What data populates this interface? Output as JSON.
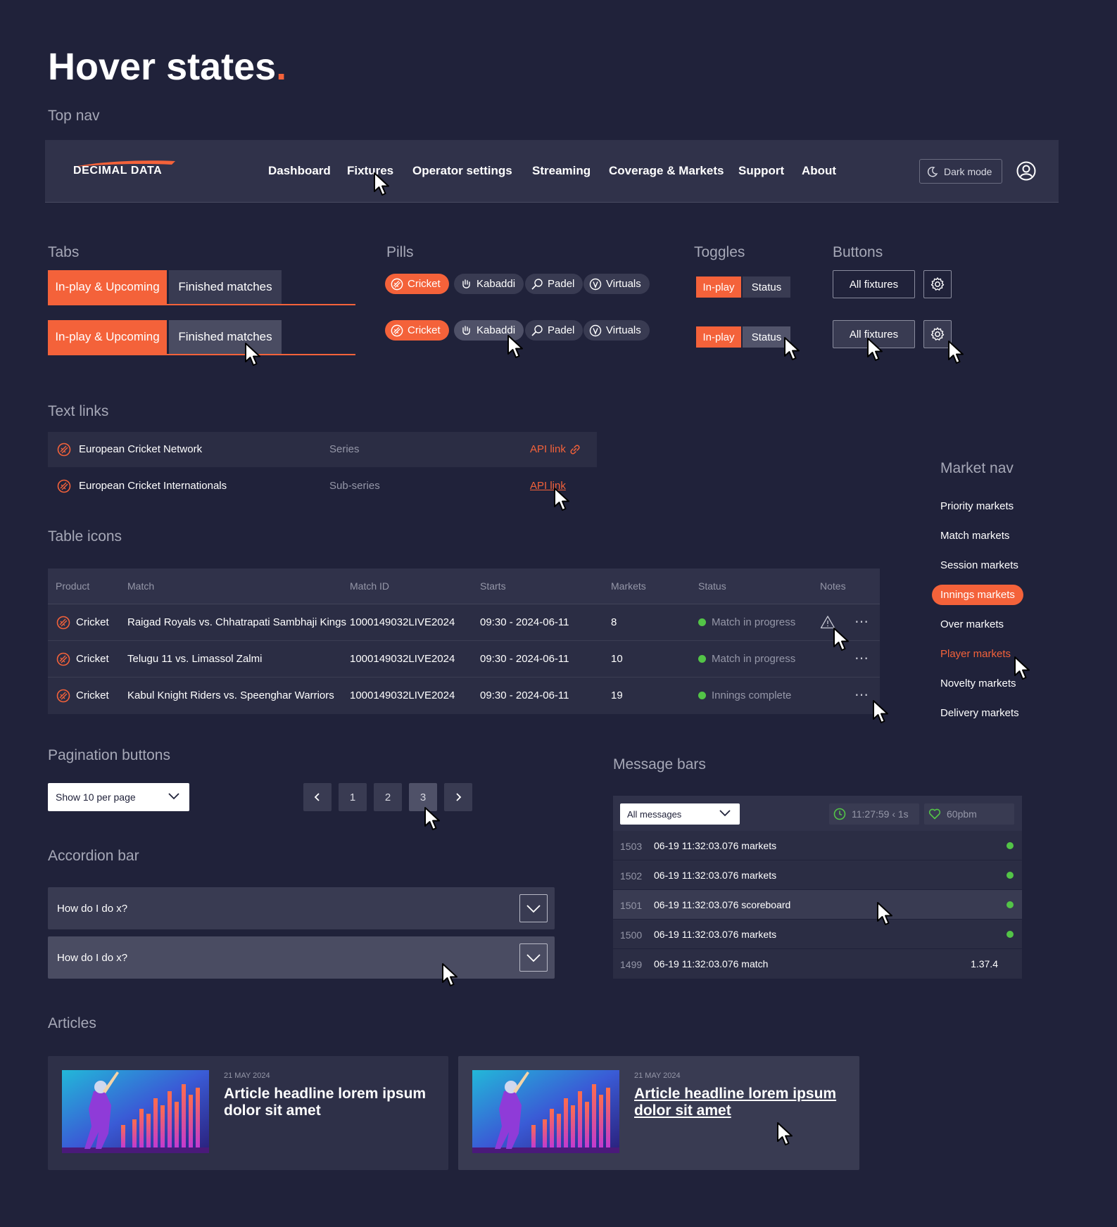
{
  "page": {
    "title": "Hover states",
    "title_dot": "."
  },
  "sections": {
    "top_nav": "Top nav",
    "tabs": "Tabs",
    "pills": "Pills",
    "toggles": "Toggles",
    "buttons": "Buttons",
    "text_links": "Text links",
    "market_nav": "Market nav",
    "table_icons": "Table icons",
    "pagination": "Pagination buttons",
    "message_bars": "Message bars",
    "accordion": "Accordion bar",
    "articles": "Articles"
  },
  "topnav": {
    "logo": "DECIMAL DATA",
    "links": [
      "Dashboard",
      "Fixtures",
      "Operator settings",
      "Streaming",
      "Coverage & Markets",
      "Support",
      "About"
    ],
    "active_link": "Fixtures",
    "dark_mode": "Dark mode"
  },
  "tabs": {
    "active": "In-play & Upcoming",
    "inactive": "Finished matches"
  },
  "pills": {
    "items": [
      "Cricket",
      "Kabaddi",
      "Padel",
      "Virtuals"
    ]
  },
  "toggles": {
    "on": "In-play",
    "off": "Status"
  },
  "buttons": {
    "all_fixtures": "All fixtures",
    "settings_icon": "gear-icon"
  },
  "text_links": [
    {
      "name": "European Cricket Network",
      "kind": "Series",
      "link": "API link"
    },
    {
      "name": "European Cricket Internationals",
      "kind": "Sub-series",
      "link": "API link"
    }
  ],
  "market_nav": {
    "items": [
      "Priority markets",
      "Match markets",
      "Session markets",
      "Innings markets",
      "Over markets",
      "Player markets",
      "Novelty markets",
      "Delivery markets"
    ],
    "active": "Innings markets",
    "hovered": "Player markets"
  },
  "table": {
    "headers": [
      "Product",
      "Match",
      "Match ID",
      "Starts",
      "Markets",
      "Status",
      "Notes"
    ],
    "rows": [
      {
        "product": "Cricket",
        "match": "Raigad Royals vs. Chhatrapati Sambhaji Kings",
        "match_id": "1000149032LIVE2024",
        "starts": "09:30 - 2024-06-11",
        "markets": "8",
        "status": "Match in progress",
        "note_icon": "warning-icon"
      },
      {
        "product": "Cricket",
        "match": "Telugu 11 vs. Limassol Zalmi",
        "match_id": "1000149032LIVE2024",
        "starts": "09:30 - 2024-06-11",
        "markets": "10",
        "status": "Match in progress"
      },
      {
        "product": "Cricket",
        "match": "Kabul Knight Riders vs. Speenghar Warriors",
        "match_id": "1000149032LIVE2024",
        "starts": "09:30 - 2024-06-11",
        "markets": "19",
        "status": "Innings complete"
      }
    ],
    "status_color": "#53c447"
  },
  "pagination": {
    "per_page": "Show 10 per page",
    "pages": [
      "1",
      "2",
      "3"
    ]
  },
  "accordion": {
    "items": [
      "How do I do x?",
      "How do I do x?"
    ]
  },
  "messages": {
    "filter": "All messages",
    "clock": "11:27:59 ‹ 1s",
    "rate": "60pbm",
    "rows": [
      {
        "id": "1503",
        "text": "06-19 11:32:03.076 markets",
        "indicator": "dot"
      },
      {
        "id": "1502",
        "text": "06-19 11:32:03.076 markets",
        "indicator": "dot"
      },
      {
        "id": "1501",
        "text": "06-19 11:32:03.076 scoreboard",
        "indicator": "dot"
      },
      {
        "id": "1500",
        "text": "06-19 11:32:03.076 markets",
        "indicator": "dot"
      },
      {
        "id": "1499",
        "text": "06-19 11:32:03.076 match",
        "indicator": "version",
        "version": "1.37.4"
      }
    ]
  },
  "articles": [
    {
      "date": "21 MAY 2024",
      "headline": "Article headline lorem ipsum dolor sit amet"
    },
    {
      "date": "21 MAY 2024",
      "headline": "Article headline lorem ipsum dolor sit amet"
    }
  ],
  "colors": {
    "background": "#20223a",
    "accent": "#f4623a",
    "status_green": "#53c447"
  }
}
